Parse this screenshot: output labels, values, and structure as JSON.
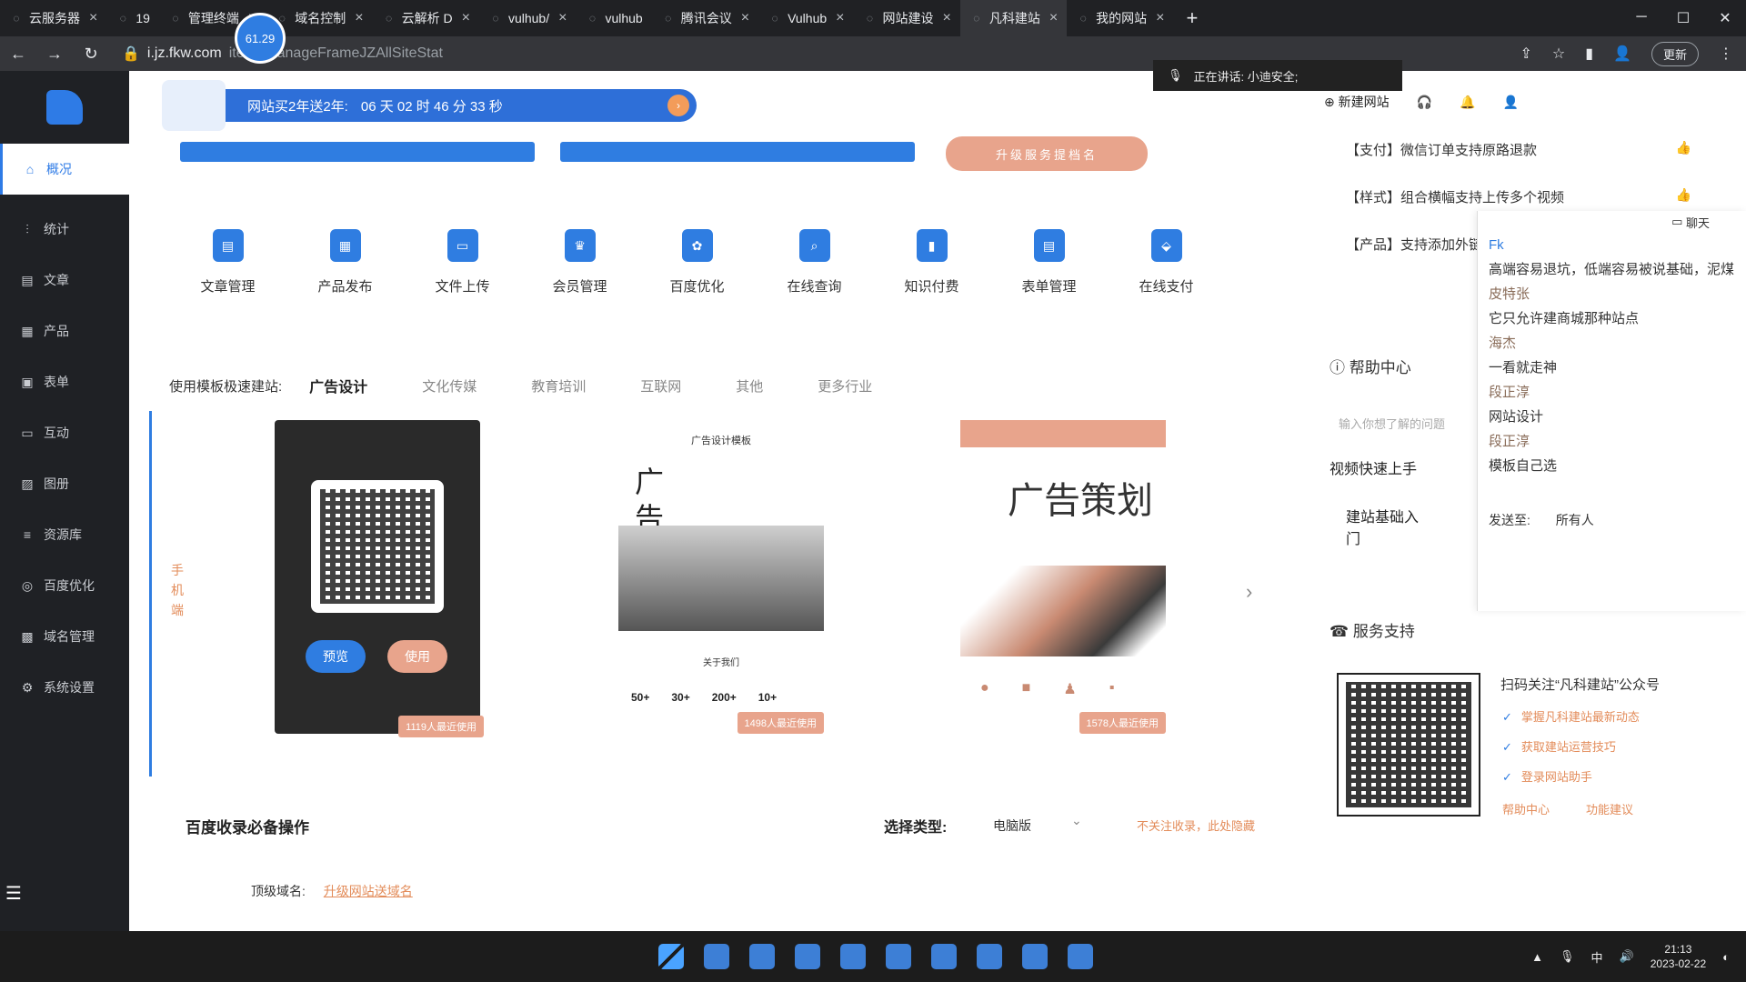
{
  "browser": {
    "tabs": [
      {
        "label": "云服务器",
        "close": "×"
      },
      {
        "label": "19",
        "close": ""
      },
      {
        "label": "管理终端",
        "close": "×"
      },
      {
        "label": "域名控制",
        "close": "×"
      },
      {
        "label": "云解析 D",
        "close": "×"
      },
      {
        "label": "vulhub/",
        "close": "×"
      },
      {
        "label": "vulhub",
        "close": ""
      },
      {
        "label": "腾讯会议",
        "close": "×"
      },
      {
        "label": "Vulhub",
        "close": "×"
      },
      {
        "label": "网站建设",
        "close": "×"
      },
      {
        "label": "凡科建站",
        "close": "×"
      },
      {
        "label": "我的网站",
        "close": "×"
      }
    ],
    "new_tab": "+",
    "bubble_value": "61.29",
    "url_host": "i.jz.fkw.com",
    "url_path": "item=manageFrameJZAllSiteStat",
    "update_label": "更新"
  },
  "voice_banner": "正在讲话: 小迪安全;",
  "sidebar": {
    "items": [
      {
        "label": "概况",
        "icon": "home-icon"
      },
      {
        "label": "统计",
        "icon": "stats-icon"
      },
      {
        "label": "文章",
        "icon": "article-icon"
      },
      {
        "label": "产品",
        "icon": "product-icon"
      },
      {
        "label": "表单",
        "icon": "form-icon"
      },
      {
        "label": "互动",
        "icon": "chat-icon"
      },
      {
        "label": "图册",
        "icon": "album-icon"
      },
      {
        "label": "资源库",
        "icon": "library-icon"
      },
      {
        "label": "百度优化",
        "icon": "baidu-icon"
      },
      {
        "label": "域名管理",
        "icon": "domain-icon"
      },
      {
        "label": "系统设置",
        "icon": "settings-icon"
      }
    ]
  },
  "promo": {
    "text": "网站买2年送2年:",
    "countdown": "06 天 02 时 46 分 33 秒"
  },
  "upgrade_label": "升级服务提档名",
  "quick_actions": [
    "文章管理",
    "产品发布",
    "文件上传",
    "会员管理",
    "百度优化",
    "在线查询",
    "知识付费",
    "表单管理",
    "在线支付"
  ],
  "templates": {
    "lead": "使用模板极速建站:",
    "tabs": [
      "广告设计",
      "文化传媒",
      "教育培训",
      "互联网",
      "其他",
      "更多行业"
    ],
    "mobile_label": "手机端",
    "card1": {
      "preview": "预览",
      "use": "使用",
      "count": "1119人最近使用"
    },
    "card2": {
      "title": "广告设计模板",
      "brush": "广告设计",
      "about": "关于我们",
      "stats": [
        "50+",
        "30+",
        "200+",
        "10+"
      ],
      "count": "1498人最近使用"
    },
    "card3": {
      "brush": "广告策划",
      "count": "1578人最近使用"
    }
  },
  "seo": {
    "title": "百度收录必备操作",
    "type_label": "选择类型:",
    "type_value": "电脑版",
    "hide_link": "不关注收录，此处隐藏",
    "domain_label": "顶级域名:",
    "domain_link": "升级网站送域名"
  },
  "top_actions": {
    "new_site": "新建网站"
  },
  "news": [
    "【支付】微信订单支持原路退款",
    "【样式】组合横幅支持上传多个视频",
    "【产品】支持添加外链"
  ],
  "help": {
    "title": "帮助中心",
    "placeholder": "输入你想了解的问题",
    "video": "视频快速上手",
    "basic": "建站基础入门"
  },
  "service": {
    "title": "服务支持",
    "follow": "扫码关注“凡科建站”公众号",
    "checks": [
      "掌握凡科建站最新动态",
      "获取建站运营技巧",
      "登录网站助手"
    ],
    "links": [
      "帮助中心",
      "功能建议"
    ]
  },
  "chat": {
    "header": "聊天",
    "messages": [
      {
        "text": "Fk",
        "type": "name"
      },
      {
        "text": "高端容易退坑，低端容易被说基础，泥煤",
        "type": "text"
      },
      {
        "text": "皮特张",
        "type": "name-gray"
      },
      {
        "text": "它只允许建商城那种站点",
        "type": "text"
      },
      {
        "text": "海杰",
        "type": "name-gray"
      },
      {
        "text": "一看就走神",
        "type": "text"
      },
      {
        "text": "段正淳",
        "type": "name-gray"
      },
      {
        "text": "网站设计",
        "type": "text"
      },
      {
        "text": "段正淳",
        "type": "name-gray"
      },
      {
        "text": "模板自己选",
        "type": "text"
      }
    ],
    "send_label": "发送至:",
    "send_value": "所有人"
  },
  "taskbar": {
    "time": "21:13",
    "date": "2023-02-22",
    "ime": "中"
  }
}
